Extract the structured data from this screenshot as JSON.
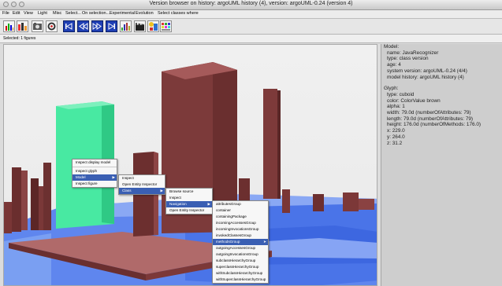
{
  "window": {
    "title": "Version browser on history: argoUML history (4), version: argoUML-0.24 (version 4)"
  },
  "menubar": {
    "items": [
      "File",
      "Edit",
      "View",
      "Light",
      "Misc",
      "Select...",
      "On selection...",
      "Experimental",
      "Evolution",
      "Select classes where"
    ]
  },
  "toolbar": {
    "buttons": [
      "layout-bars-icon",
      "bar-chart-icon",
      "camera-icon",
      "reset-view-icon",
      "first-version-icon",
      "previous-version-icon",
      "next-version-icon",
      "last-version-icon",
      "chart-view-icon",
      "movie-clapper-icon",
      "sun-flower-icon",
      "color-palette-icon"
    ]
  },
  "status": {
    "text": "Selected: 1 figures"
  },
  "info": {
    "model": {
      "heading": "Model:",
      "lines": [
        "name: JavaRecognizer",
        "type: class version",
        "age: 4",
        "system version: argoUML-0.24 (4/4)",
        "model history: argoUML history (4)"
      ]
    },
    "glyph": {
      "heading": "Glyph:",
      "lines": [
        "type: cuboid",
        "color: ColorValue brown",
        "alpha: 1",
        "width: 79.0d (numberOfAttributes: 79)",
        "length: 79.0d (numberOfAttributes: 79)",
        "height: 176.0d (numberOfMethods: 176.0)",
        "x: 229.0",
        "y: 264.0",
        "z: 31.2"
      ]
    }
  },
  "menus": {
    "context": {
      "items": [
        "Inspect display model",
        "Inspect glyph",
        "Model",
        "Inspect figure"
      ]
    },
    "model": {
      "items": [
        "Inspect",
        "Open Entity Inspector",
        "Class"
      ]
    },
    "class": {
      "items": [
        "Browse source",
        "Inspect",
        "Navigation",
        "Open Entity Inspector"
      ]
    },
    "navigation": {
      "items": [
        "attributesGroup",
        "container",
        "containingPackage",
        "incomingAccessesGroup",
        "incomingInvocationsGroup",
        "invokedClassesGroup",
        "methodsGroup",
        "outgoingAccessesGroup",
        "outgoingInvocationsGroup",
        "subclassHierarchyGroup",
        "superclassHierarchyGroup",
        "withSubclassHierarchyGroup",
        "withSuperclassHierarchyGroup"
      ]
    }
  },
  "colors": {
    "selected_cuboid": "#3ee79a",
    "brown_cuboid": "#7a3a3a",
    "blue_floor": "#6f8ff0",
    "menu_highlight": "#3a5fb3"
  }
}
